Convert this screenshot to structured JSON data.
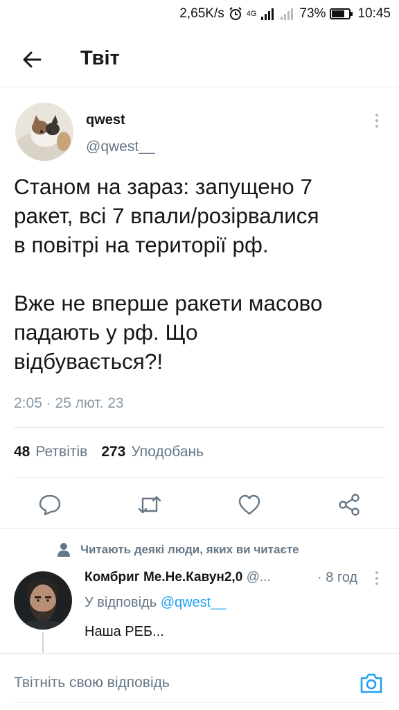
{
  "status_bar": {
    "speed": "2,65K/s",
    "network": "4G",
    "battery": "73%",
    "time": "10:45",
    "icons": [
      "alarm-icon",
      "signal-icon",
      "signal-icon-2",
      "battery-icon"
    ]
  },
  "header": {
    "title": "Твіт",
    "back_icon": "arrow-left-icon"
  },
  "tweet": {
    "author_name": "qwest",
    "author_handle": "@qwest__",
    "text": "Станом на зараз: запущено 7\nракет, всі 7 впали/розірвалися\nв повітрі на території рф.\n\nВже не вперше ракети масово\nпадають у рф. Що\nвідбувається?!",
    "timestamp": "2:05 · 25 лют. 23",
    "retweets_count": "48",
    "retweets_label": "Ретвітів",
    "likes_count": "273",
    "likes_label": "Уподобань"
  },
  "actions": {
    "reply_icon": "reply-icon",
    "retweet_icon": "retweet-icon",
    "like_icon": "heart-icon",
    "share_icon": "share-icon"
  },
  "social_context": {
    "text": "Читають деякі люди, яких ви читаєте",
    "icon": "person-icon"
  },
  "reply": {
    "author_name": "Комбриг Ме.Не.Кавун2,0",
    "author_handle": "@...",
    "time": "· 8 год",
    "reply_to_prefix": "У відповідь",
    "reply_to_mention": "@qwest__",
    "text": "Наша РЕБ..."
  },
  "compose": {
    "placeholder": "Твітніть свою відповідь",
    "camera_icon": "camera-icon"
  },
  "colors": {
    "accent": "#1da1f2",
    "secondary_text": "#657786",
    "divider": "#e6ecf0"
  }
}
